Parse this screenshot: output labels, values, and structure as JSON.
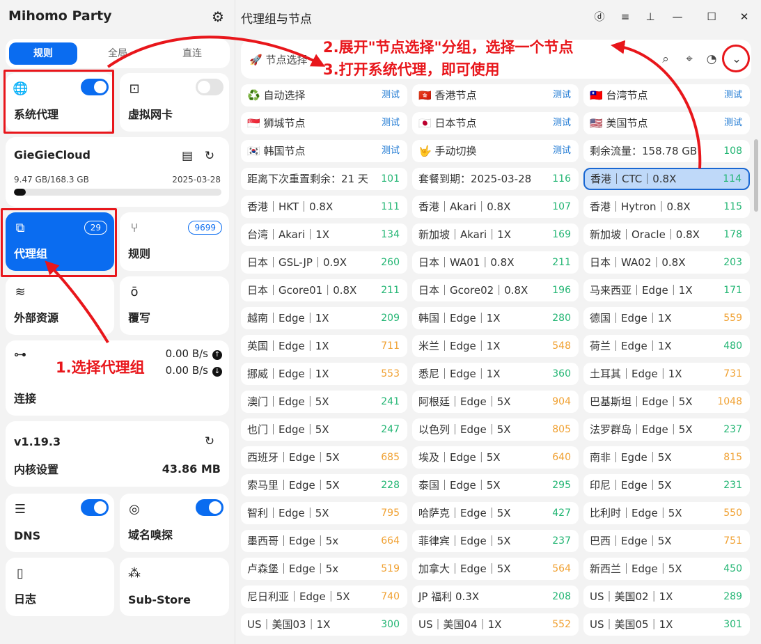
{
  "app": {
    "title": "Mihomo Party"
  },
  "mode": {
    "items": [
      "规则",
      "全局",
      "直连"
    ],
    "active": 0
  },
  "cards": {
    "system_proxy": {
      "label": "系统代理",
      "enabled": true
    },
    "tun": {
      "label": "虚拟网卡",
      "enabled": false
    },
    "subscription": {
      "name": "GieGieCloud",
      "usage": "9.47 GB/168.3 GB",
      "expire": "2025-03-28",
      "used_fraction": 0.056
    },
    "proxy_groups": {
      "label": "代理组",
      "count": "29"
    },
    "rules": {
      "label": "规则",
      "count": "9699"
    },
    "resources": {
      "label": "外部资源"
    },
    "override": {
      "label": "覆写"
    },
    "connections": {
      "label": "连接",
      "upload": "0.00 B/s",
      "download": "0.00 B/s"
    },
    "core": {
      "version": "v1.19.3",
      "label": "内核设置",
      "memory": "43.86 MB"
    },
    "dns": {
      "label": "DNS",
      "enabled": true
    },
    "sniff": {
      "label": "域名嗅探",
      "enabled": true
    },
    "logs": {
      "label": "日志"
    },
    "substore": {
      "label": "Sub-Store"
    }
  },
  "main": {
    "title": "代理组与节点",
    "group_header": {
      "name": "节点选择"
    },
    "test_label": "测试",
    "groups": [
      {
        "name": "自动选择",
        "icon": "♻️"
      },
      {
        "name": "香港节点",
        "icon": "🇭🇰"
      },
      {
        "name": "台湾节点",
        "icon": "🇹🇼"
      },
      {
        "name": "狮城节点",
        "icon": "🇸🇬"
      },
      {
        "name": "日本节点",
        "icon": "🇯🇵"
      },
      {
        "name": "美国节点",
        "icon": "🇺🇸"
      },
      {
        "name": "韩国节点",
        "icon": "🇰🇷"
      },
      {
        "name": "手动切换",
        "icon": "🤟"
      }
    ],
    "nodes": [
      {
        "name": "剩余流量：158.78 GB",
        "delay": "108"
      },
      {
        "name": "距离下次重置剩余：21 天",
        "delay": "101"
      },
      {
        "name": "套餐到期：2025-03-28",
        "delay": "116"
      },
      {
        "name": "香港｜CTC｜0.8X",
        "delay": "114",
        "selected": true
      },
      {
        "name": "香港｜HKT｜0.8X",
        "delay": "111"
      },
      {
        "name": "香港｜Akari｜0.8X",
        "delay": "107"
      },
      {
        "name": "香港｜Hytron｜0.8X",
        "delay": "115"
      },
      {
        "name": "台湾｜Akari｜1X",
        "delay": "134"
      },
      {
        "name": "新加坡｜Akari｜1X",
        "delay": "169"
      },
      {
        "name": "新加坡｜Oracle｜0.8X",
        "delay": "178"
      },
      {
        "name": "日本｜GSL-JP｜0.9X",
        "delay": "260"
      },
      {
        "name": "日本｜WA01｜0.8X",
        "delay": "211"
      },
      {
        "name": "日本｜WA02｜0.8X",
        "delay": "203"
      },
      {
        "name": "日本｜Gcore01｜0.8X",
        "delay": "211"
      },
      {
        "name": "日本｜Gcore02｜0.8X",
        "delay": "196"
      },
      {
        "name": "马来西亚｜Edge｜1X",
        "delay": "171"
      },
      {
        "name": "越南｜Edge｜1X",
        "delay": "209"
      },
      {
        "name": "韩国｜Edge｜1X",
        "delay": "280"
      },
      {
        "name": "德国｜Edge｜1X",
        "delay": "559"
      },
      {
        "name": "英国｜Edge｜1X",
        "delay": "711"
      },
      {
        "name": "米兰｜Edge｜1X",
        "delay": "548"
      },
      {
        "name": "荷兰｜Edge｜1X",
        "delay": "480"
      },
      {
        "name": "挪威｜Edge｜1X",
        "delay": "553"
      },
      {
        "name": "悉尼｜Edge｜1X",
        "delay": "360"
      },
      {
        "name": "土耳其｜Edge｜1X",
        "delay": "731"
      },
      {
        "name": "澳门｜Edge｜5X",
        "delay": "241"
      },
      {
        "name": "阿根廷｜Edge｜5X",
        "delay": "904"
      },
      {
        "name": "巴基斯坦｜Edge｜5X",
        "delay": "1048"
      },
      {
        "name": "也门｜Edge｜5X",
        "delay": "247"
      },
      {
        "name": "以色列｜Edge｜5X",
        "delay": "805"
      },
      {
        "name": "法罗群岛｜Edge｜5X",
        "delay": "237"
      },
      {
        "name": "西班牙｜Edge｜5X",
        "delay": "685"
      },
      {
        "name": "埃及｜Edge｜5X",
        "delay": "640"
      },
      {
        "name": "南非｜Egde｜5X",
        "delay": "815"
      },
      {
        "name": "索马里｜Edge｜5X",
        "delay": "228"
      },
      {
        "name": "泰国｜Edge｜5X",
        "delay": "295"
      },
      {
        "name": "印尼｜Edge｜5X",
        "delay": "231"
      },
      {
        "name": "智利｜Edge｜5X",
        "delay": "795"
      },
      {
        "name": "哈萨克｜Edge｜5X",
        "delay": "427"
      },
      {
        "name": "比利时｜Edge｜5X",
        "delay": "550"
      },
      {
        "name": "墨西哥｜Edge｜5x",
        "delay": "664"
      },
      {
        "name": "菲律宾｜Edge｜5X",
        "delay": "237"
      },
      {
        "name": "巴西｜Edge｜5X",
        "delay": "751"
      },
      {
        "name": "卢森堡｜Edge｜5x",
        "delay": "519"
      },
      {
        "name": "加拿大｜Edge｜5X",
        "delay": "564"
      },
      {
        "name": "新西兰｜Edge｜5X",
        "delay": "450"
      },
      {
        "name": "尼日利亚｜Edge｜5X",
        "delay": "740"
      },
      {
        "name": "JP 福利 0.3X",
        "delay": "208"
      },
      {
        "name": "US｜美国02｜1X",
        "delay": "289"
      },
      {
        "name": "US｜美国03｜1X",
        "delay": "300"
      },
      {
        "name": "US｜美国04｜1X",
        "delay": "552"
      },
      {
        "name": "US｜美国05｜1X",
        "delay": "301"
      }
    ]
  },
  "annotations": {
    "step1": "1.选择代理组",
    "step2": "2.展开\"节点选择\"分组，选择一个节点",
    "step3": "3.打开系统代理，即可使用"
  },
  "colors": {
    "accent": "#0a6cf0",
    "delay_good": "#22b573",
    "delay_warn": "#f0a030",
    "annotation": "#e8161b",
    "selected_bg": "#bfd9f9"
  },
  "icons": [
    "gear-icon",
    "globe-icon",
    "tun-icon",
    "file-icon",
    "refresh-icon",
    "proxy-groups-icon",
    "fork-icon",
    "layers-icon",
    "override-icon",
    "link-icon",
    "dns-icon",
    "sniff-icon",
    "log-icon",
    "substore-icon",
    "rocket-icon",
    "search-icon",
    "locate-icon",
    "speed-icon",
    "chevron-down-icon"
  ]
}
